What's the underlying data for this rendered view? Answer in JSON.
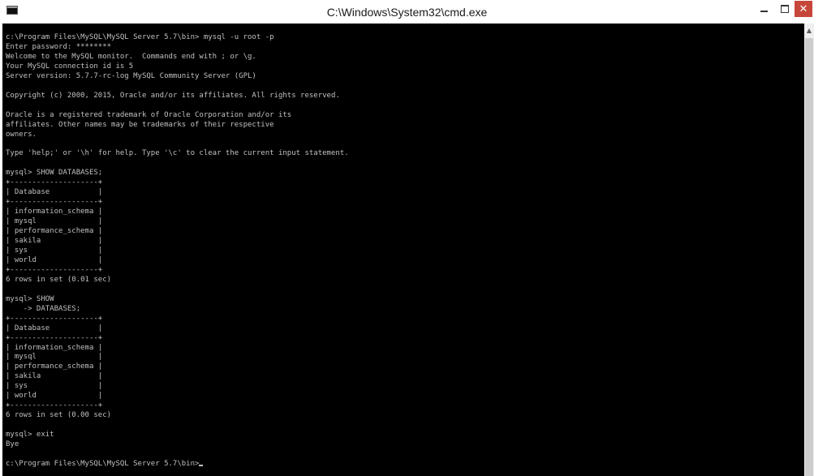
{
  "window": {
    "title": "C:\\Windows\\System32\\cmd.exe",
    "controls": {
      "minimize": "–",
      "maximize": "□",
      "close": "✕"
    }
  },
  "console": {
    "lines": [
      "c:\\Program Files\\MySQL\\MySQL Server 5.7\\bin> mysql -u root -p",
      "Enter password: ********",
      "Welcome to the MySQL monitor.  Commands end with ; or \\g.",
      "Your MySQL connection id is 5",
      "Server version: 5.7.7-rc-log MySQL Community Server (GPL)",
      "",
      "Copyright (c) 2000, 2015, Oracle and/or its affiliates. All rights reserved.",
      "",
      "Oracle is a registered trademark of Oracle Corporation and/or its",
      "affiliates. Other names may be trademarks of their respective",
      "owners.",
      "",
      "Type 'help;' or '\\h' for help. Type '\\c' to clear the current input statement.",
      "",
      "mysql> SHOW DATABASES;",
      "+--------------------+",
      "| Database           |",
      "+--------------------+",
      "| information_schema |",
      "| mysql              |",
      "| performance_schema |",
      "| sakila             |",
      "| sys                |",
      "| world              |",
      "+--------------------+",
      "6 rows in set (0.01 sec)",
      "",
      "mysql> SHOW",
      "    -> DATABASES;",
      "+--------------------+",
      "| Database           |",
      "+--------------------+",
      "| information_schema |",
      "| mysql              |",
      "| performance_schema |",
      "| sakila             |",
      "| sys                |",
      "| world              |",
      "+--------------------+",
      "6 rows in set (0.00 sec)",
      "",
      "mysql> exit",
      "Bye",
      ""
    ],
    "prompt": "c:\\Program Files\\MySQL\\MySQL Server 5.7\\bin>"
  },
  "colors": {
    "console_background": "#000000",
    "console_text": "#c0c0c0",
    "close_button": "#c7463a"
  },
  "icons": {
    "app": "console-icon",
    "scroll_up": "scroll-up-arrow-icon"
  }
}
